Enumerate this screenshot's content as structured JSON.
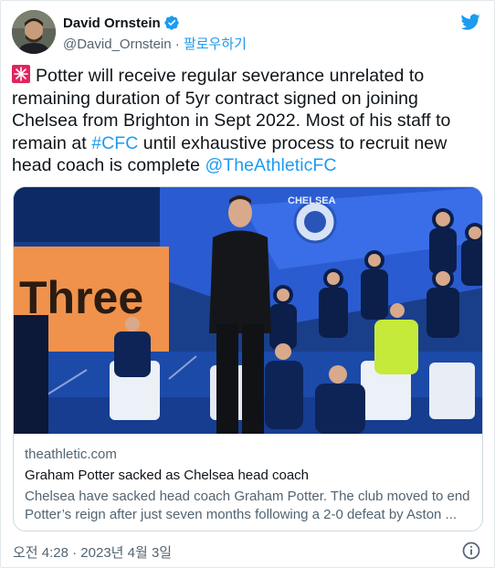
{
  "author": {
    "name": "David Ornstein",
    "handle": "@David_Ornstein",
    "separator": "·",
    "follow_label": "팔로우하기",
    "verified": true
  },
  "tweet": {
    "text_main": "Potter will receive regular severance unrelated to remaining duration of 5yr contract signed on joining Chelsea from Brighton in Sept 2022. Most of his staff to remain at ",
    "hashtag": "#CFC",
    "text_mid": " until exhaustive process to recruit new head coach is complete ",
    "mention": "@TheAthleticFC",
    "leading_emoji": "siren-icon"
  },
  "link_card": {
    "domain": "theathletic.com",
    "title": "Graham Potter sacked as Chelsea head coach",
    "description": "Chelsea have sacked head coach Graham Potter. The club moved to end Potter’s reign after just seven months following a 2-0 defeat by Aston ...",
    "photo_sign_text": "Three",
    "photo_banner_text": "CHELSEA"
  },
  "footer": {
    "timestamp": "오전 4:28 · 2023년 4월 3일"
  },
  "colors": {
    "link": "#1d9bf0",
    "text": "#0f1419",
    "muted": "#536471",
    "border": "#cfd9de",
    "chelsea_blue": "#034694"
  },
  "icons": [
    "twitter-bird-icon",
    "verified-badge-icon",
    "siren-icon",
    "info-icon"
  ]
}
